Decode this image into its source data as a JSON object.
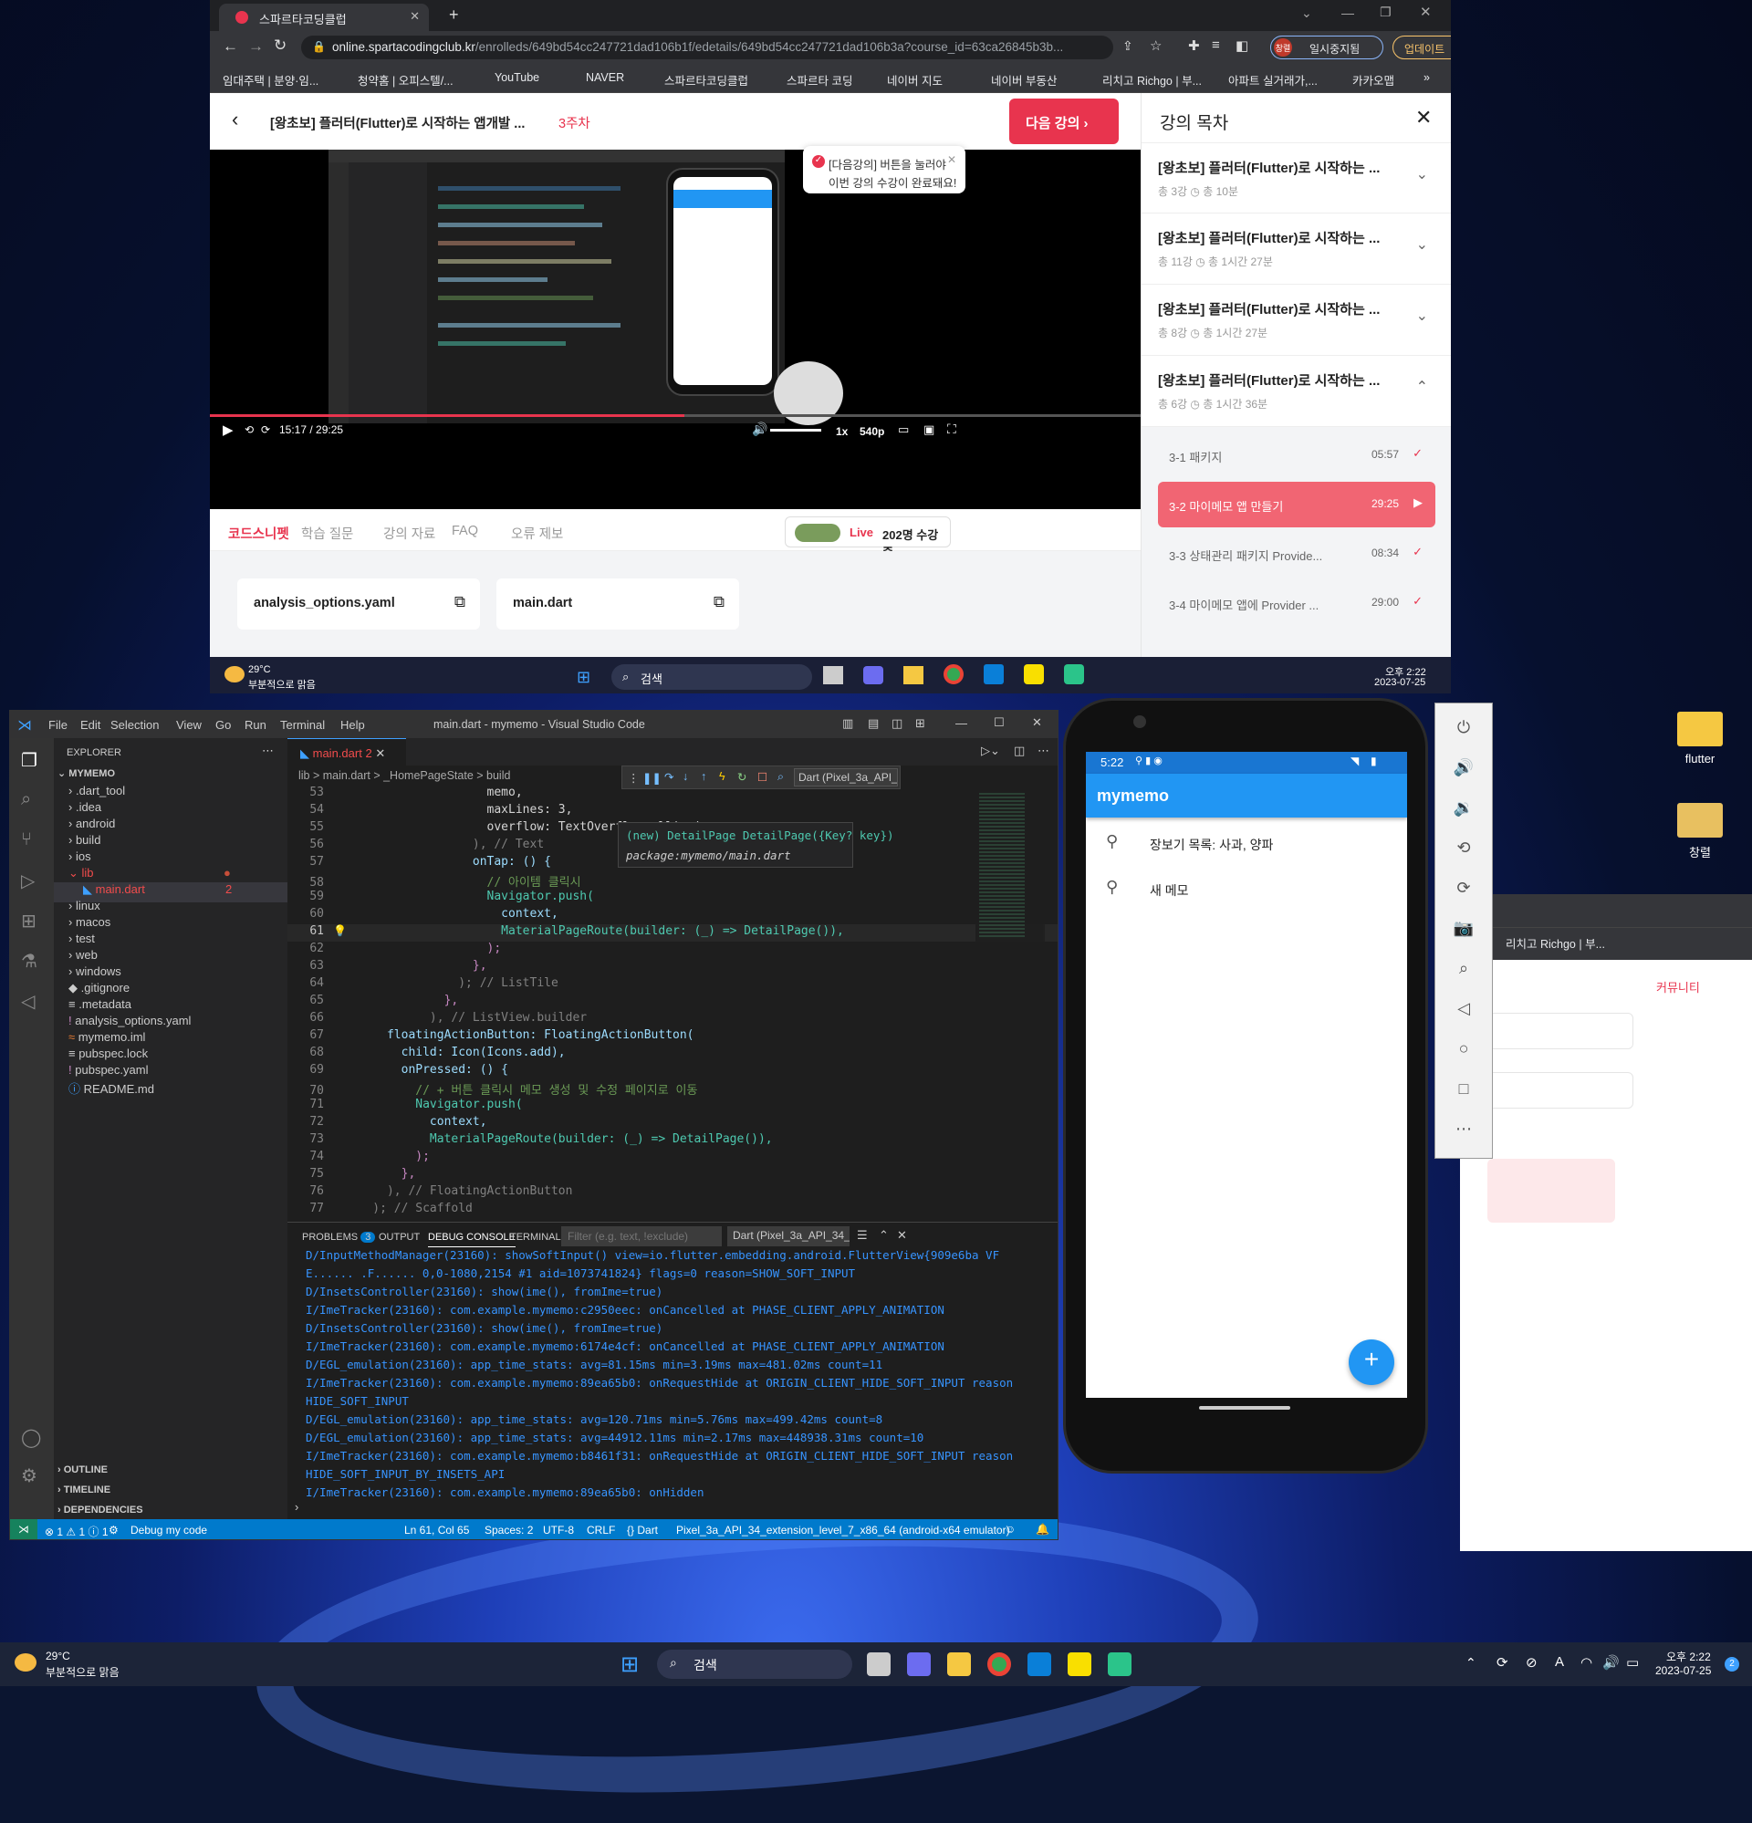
{
  "browser": {
    "tab_title": "스파르타코딩클럽",
    "url_host": "online.spartacodingclub.kr",
    "url_path": "/enrolleds/649bd54cc247721dad106b1f/edetails/649bd54cc247721dad106b3a?course_id=63ca26845b3b...",
    "profile_badge": "창렬",
    "paused_label": "일시중지됨",
    "update_label": "업데이트",
    "bookmarks": [
      "임대주택 | 분양·임...",
      "청약홈 | 오피스텔/...",
      "YouTube",
      "NAVER",
      "스파르타코딩클럽",
      "스파르타 코딩",
      "네이버 지도",
      "네이버 부동산",
      "리치고 Richgo | 부...",
      "아파트 실거래가,...",
      "카카오맵"
    ]
  },
  "course": {
    "title": "[왕초보] 플러터(Flutter)로 시작하는 앱개발 ...",
    "week": "3주차",
    "next_button": "다음 강의",
    "toast_line1": "[다음강의] 버튼을 눌러야",
    "toast_line2": "이번 강의 수강이 완료돼요!",
    "video_current": "15:17 /",
    "video_total": "29:25",
    "speed": "1x",
    "quality": "540p",
    "tabs": [
      "코드스니펫",
      "학습 질문",
      "강의 자료",
      "FAQ",
      "오류 제보"
    ],
    "live_label": "Live",
    "live_count": "202명 수강 중",
    "snippets": [
      "analysis_options.yaml",
      "main.dart"
    ]
  },
  "toc": {
    "heading": "강의 목차",
    "weeks": [
      {
        "title": "[왕초보] 플러터(Flutter)로 시작하는 ...",
        "count": "총 3강",
        "time": "총 10분"
      },
      {
        "title": "[왕초보] 플러터(Flutter)로 시작하는 ...",
        "count": "총 11강",
        "time": "총 1시간 27분"
      },
      {
        "title": "[왕초보] 플러터(Flutter)로 시작하는 ...",
        "count": "총 8강",
        "time": "총 1시간 27분"
      },
      {
        "title": "[왕초보] 플러터(Flutter)로 시작하는 ...",
        "count": "총 6강",
        "time": "총 1시간 36분"
      }
    ],
    "lessons": [
      {
        "num": "3-1",
        "name": "패키지",
        "dur": "05:57"
      },
      {
        "num": "3-2",
        "name": "마이메모 앱 만들기",
        "dur": "29:25"
      },
      {
        "num": "3-3",
        "name": "상태관리 패키지 Provide...",
        "dur": "08:34"
      },
      {
        "num": "3-4",
        "name": "마이메모 앱에 Provider ...",
        "dur": "29:00"
      }
    ]
  },
  "taskbar": {
    "temp": "29°C",
    "weather": "부분적으로 맑음",
    "search": "검색",
    "time": "오후 2:22",
    "date": "2023-07-25",
    "notif": "2"
  },
  "vscode": {
    "menu": [
      "File",
      "Edit",
      "Selection",
      "View",
      "Go",
      "Run",
      "Terminal",
      "Help"
    ],
    "title": "main.dart - mymemo - Visual Studio Code",
    "explorer": "EXPLORER",
    "project": "MYMEMO",
    "tab": "main.dart",
    "tab_badge": "2",
    "breadcrumb": "lib > main.dart > _HomePageState > build",
    "device": "Dart (Pixel_3a_API_3",
    "files": [
      ".dart_tool",
      ".idea",
      "android",
      "build",
      "ios",
      "lib",
      "main.dart",
      "linux",
      "macos",
      "test",
      "web",
      "windows",
      ".gitignore",
      ".metadata",
      "analysis_options.yaml",
      "mymemo.iml",
      "pubspec.lock",
      "pubspec.yaml",
      "README.md"
    ],
    "outline": [
      "OUTLINE",
      "TIMELINE",
      "DEPENDENCIES"
    ],
    "code": [
      {
        "n": "53",
        "t": "                    memo,"
      },
      {
        "n": "54",
        "t": "                    maxLines: 3,"
      },
      {
        "n": "55",
        "t": "                    overflow: TextOverflow.ellipsis,"
      },
      {
        "n": "56",
        "t": "                  ), // Text"
      },
      {
        "n": "57",
        "t": "                  onTap: () {"
      },
      {
        "n": "58",
        "t": "                    // 아이템 클릭시"
      },
      {
        "n": "59",
        "t": "                    Navigator.push("
      },
      {
        "n": "60",
        "t": "                      context,"
      },
      {
        "n": "61",
        "t": "                      MaterialPageRoute(builder: (_) => DetailPage()),"
      },
      {
        "n": "62",
        "t": "                    );"
      },
      {
        "n": "63",
        "t": "                  },"
      },
      {
        "n": "64",
        "t": "                ); // ListTile"
      },
      {
        "n": "65",
        "t": "              },"
      },
      {
        "n": "66",
        "t": "            ), // ListView.builder"
      },
      {
        "n": "67",
        "t": "      floatingActionButton: FloatingActionButton("
      },
      {
        "n": "68",
        "t": "        child: Icon(Icons.add),"
      },
      {
        "n": "69",
        "t": "        onPressed: () {"
      },
      {
        "n": "70",
        "t": "          // + 버튼 클릭시 메모 생성 및 수정 페이지로 이동"
      },
      {
        "n": "71",
        "t": "          Navigator.push("
      },
      {
        "n": "72",
        "t": "            context,"
      },
      {
        "n": "73",
        "t": "            MaterialPageRoute(builder: (_) => DetailPage()),"
      },
      {
        "n": "74",
        "t": "          );"
      },
      {
        "n": "75",
        "t": "        },"
      },
      {
        "n": "76",
        "t": "      ), // FloatingActionButton"
      },
      {
        "n": "77",
        "t": "    ); // Scaffold"
      }
    ],
    "hover_sig": "(new) DetailPage DetailPage({Key? key})",
    "hover_pkg": "package:mymemo/main.dart",
    "panel_tabs": [
      "PROBLEMS",
      "OUTPUT",
      "DEBUG CONSOLE",
      "TERMINAL"
    ],
    "problems_count": "3",
    "filter_placeholder": "Filter (e.g. text, !exclude)",
    "panel_device": "Dart (Pixel_3a_API_34_e",
    "console": [
      "D/InputMethodManager(23160): showSoftInput() view=io.flutter.embedding.android.FlutterView{909e6ba VF",
      "E...... .F...... 0,0-1080,2154 #1 aid=1073741824} flags=0 reason=SHOW_SOFT_INPUT",
      "D/InsetsController(23160): show(ime(), fromIme=true)",
      "I/ImeTracker(23160): com.example.mymemo:c2950eec: onCancelled at PHASE_CLIENT_APPLY_ANIMATION",
      "D/InsetsController(23160): show(ime(), fromIme=true)",
      "I/ImeTracker(23160): com.example.mymemo:6174e4cf: onCancelled at PHASE_CLIENT_APPLY_ANIMATION",
      "D/EGL_emulation(23160): app_time_stats: avg=81.15ms min=3.19ms max=481.02ms count=11",
      "I/ImeTracker(23160): com.example.mymemo:89ea65b0: onRequestHide at ORIGIN_CLIENT_HIDE_SOFT_INPUT reason",
      "HIDE_SOFT_INPUT",
      "D/EGL_emulation(23160): app_time_stats: avg=120.71ms min=5.76ms max=499.42ms count=8",
      "D/EGL_emulation(23160): app_time_stats: avg=44912.11ms min=2.17ms max=448938.31ms count=10",
      "I/ImeTracker(23160): com.example.mymemo:b8461f31: onRequestHide at ORIGIN_CLIENT_HIDE_SOFT_INPUT reason",
      "HIDE_SOFT_INPUT_BY_INSETS_API",
      "I/ImeTracker(23160): com.example.mymemo:89ea65b0: onHidden"
    ],
    "status": {
      "errors": "⊗ 1 ⚠ 1 ⓘ 1",
      "debug": "Debug my code",
      "pos": "Ln 61, Col 65",
      "spaces": "Spaces: 2",
      "enc": "UTF-8",
      "eol": "CRLF",
      "lang": "{} Dart",
      "device": "Pixel_3a_API_34_extension_level_7_x86_64 (android-x64 emulator)"
    }
  },
  "emulator": {
    "clock": "5:22",
    "app_title": "mymemo",
    "memos": [
      "장보기 목록: 사과, 양파",
      "새 메모"
    ],
    "fab": "+"
  },
  "desktop": {
    "icons": [
      "flutter",
      "창렬"
    ],
    "bg_nav": "커뮤니티",
    "bg_bookmark": "리치고 Richgo | 부..."
  }
}
